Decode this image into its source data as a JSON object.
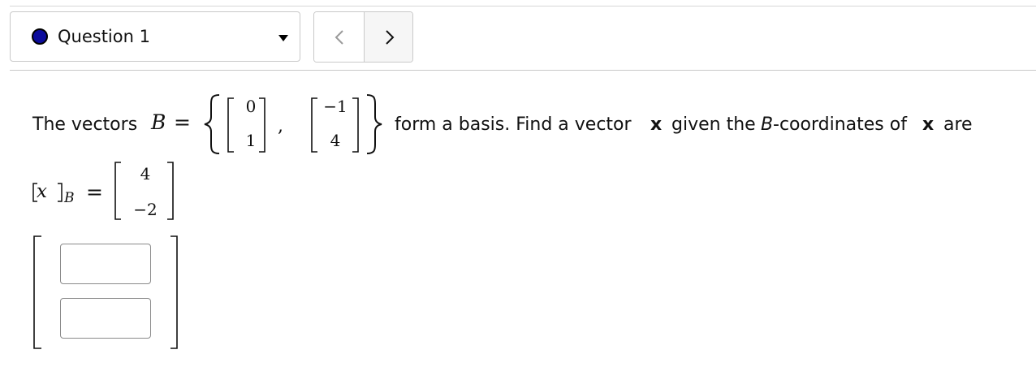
{
  "nav": {
    "question_label": "Question 1",
    "status_color": "#0b0b9c",
    "dropdown_icon": "caret-down-icon",
    "prev_icon": "chevron-left-icon",
    "next_icon": "chevron-right-icon"
  },
  "problem": {
    "lead_text": "The vectors",
    "basis_symbol": "B",
    "equals": "=",
    "comma": ",",
    "v1": [
      "0",
      "1"
    ],
    "v2": [
      "−1",
      "4"
    ],
    "tail_text_1": "form a basis. Find a vector",
    "bold_x": "x",
    "tail_text_2": "given the",
    "tail_italic_b": "B",
    "tail_text_3": "-coordinates of",
    "tail_text_4": "are",
    "coord_x": "x",
    "coord_sub": "B",
    "coord_vector": [
      "4",
      "−2"
    ]
  },
  "answer": {
    "entries": [
      "",
      ""
    ]
  }
}
